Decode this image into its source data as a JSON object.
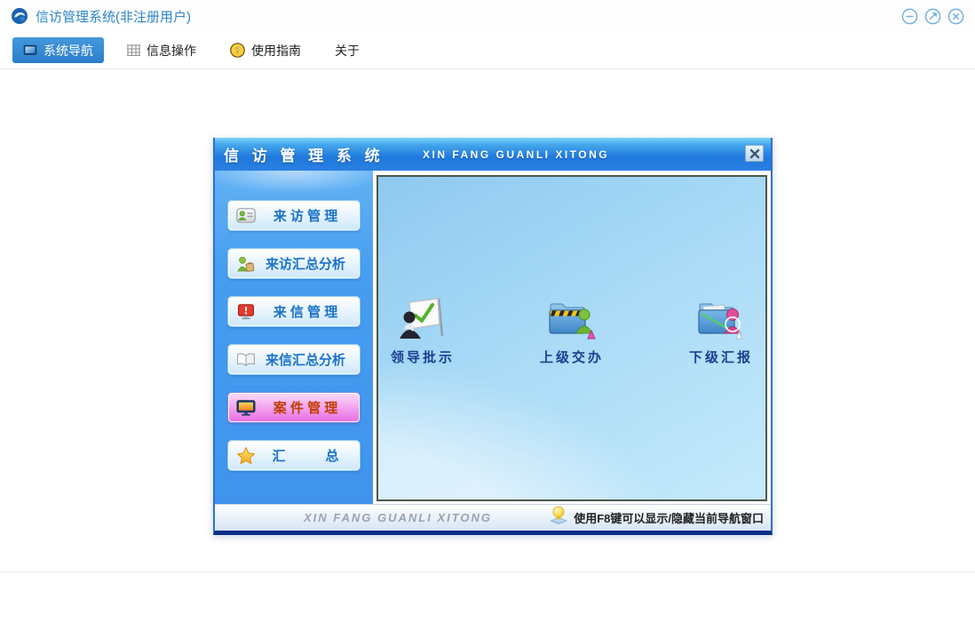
{
  "window": {
    "title": "信访管理系统(非注册用户)",
    "logo_icon": "cloud-globe-icon",
    "controls": [
      {
        "name": "minimize",
        "icon": "circle-minus-icon"
      },
      {
        "name": "maximize",
        "icon": "circle-restore-icon"
      },
      {
        "name": "close",
        "icon": "circle-x-icon"
      }
    ]
  },
  "toolbar": {
    "tabs": [
      {
        "label": "系统导航",
        "icon": "monitor-icon",
        "active": true
      },
      {
        "label": "信息操作",
        "icon": "grid-icon",
        "active": false
      },
      {
        "label": "使用指南",
        "icon": "help-coin-icon",
        "active": false
      },
      {
        "label": "关于",
        "icon": "",
        "active": false
      }
    ]
  },
  "dialog": {
    "title": "信 访 管 理 系 统",
    "subtitle": "XIN FANG GUANLI XITONG",
    "close_icon": "x-icon",
    "sidebar": {
      "items": [
        {
          "label": "来 访 管 理",
          "icon": "visitor-card-icon",
          "active": false
        },
        {
          "label": "来访汇总分析",
          "icon": "person-bag-icon",
          "active": false
        },
        {
          "label": "来 信 管 理",
          "icon": "alert-screen-icon",
          "active": false
        },
        {
          "label": "来信汇总分析",
          "icon": "open-book-icon",
          "active": false
        },
        {
          "label": "案 件 管 理",
          "icon": "case-monitor-icon",
          "active": true
        },
        {
          "label": "汇　　　总",
          "icon": "star-icon",
          "active": false
        }
      ]
    },
    "content": {
      "items": [
        {
          "label": "领导批示",
          "icon": "leader-flipchart-icon"
        },
        {
          "label": "上级交办",
          "icon": "folder-assign-icon"
        },
        {
          "label": "下级汇报",
          "icon": "folder-report-icon"
        }
      ]
    },
    "footer": {
      "brand": "XIN FANG GUANLI XITONG",
      "hint_icon": "lightbulb-icon",
      "hint": "使用F8键可以显示/隐藏当前导航窗口"
    }
  },
  "colors": {
    "accent_blue": "#2a7ec9",
    "title_text": "#2e86c8",
    "dialog_header_blue": "#1f78dc",
    "dialog_border_bottom": "#0a2f86",
    "sidebar_blue": "#479ef0",
    "button_text": "#1a73c9",
    "active_button_pink": "#e96fe4",
    "active_button_text": "#c23a00",
    "content_panel_blue": "#a5d8f6",
    "content_label_navy": "#1b3f8f"
  }
}
